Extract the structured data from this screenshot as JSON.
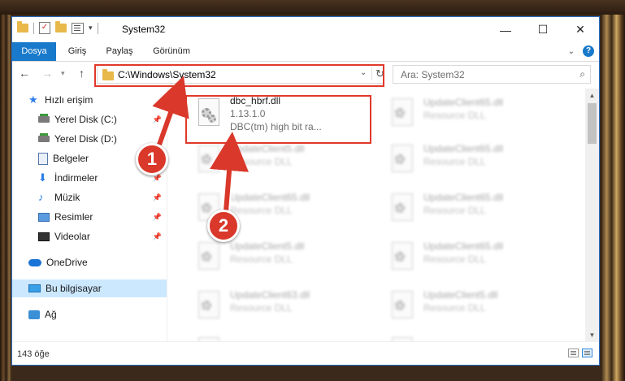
{
  "window": {
    "title": "System32",
    "controls": [
      "—",
      "☐",
      "✕"
    ]
  },
  "ribbon": {
    "tabs": [
      "Dosya",
      "Giriş",
      "Paylaş",
      "Görünüm"
    ],
    "help": "?"
  },
  "address": {
    "path": "C:\\Windows\\System32"
  },
  "search": {
    "placeholder": "Ara: System32"
  },
  "sidebar": {
    "items": [
      {
        "label": "Hızlı erişim",
        "icon": "star-icon"
      },
      {
        "label": "Yerel Disk (C:)",
        "icon": "disk-icon"
      },
      {
        "label": "Yerel Disk (D:)",
        "icon": "disk-icon"
      },
      {
        "label": "Belgeler",
        "icon": "document-icon"
      },
      {
        "label": "İndirmeler",
        "icon": "download-icon"
      },
      {
        "label": "Müzik",
        "icon": "music-icon"
      },
      {
        "label": "Resimler",
        "icon": "picture-icon"
      },
      {
        "label": "Videolar",
        "icon": "video-icon"
      },
      {
        "label": "OneDrive",
        "icon": "cloud-icon"
      },
      {
        "label": "Bu bilgisayar",
        "icon": "computer-icon"
      },
      {
        "label": "Ağ",
        "icon": "network-icon"
      }
    ]
  },
  "files": [
    {
      "name": "dbc_hbrf.dll",
      "version": "1.13.1.0",
      "description": "DBC(tm) high bit ra..."
    },
    {
      "name": "UpdateClient65.dll",
      "description": "Resource DLL"
    },
    {
      "name": "UpdateClient5.dll",
      "description": "Resource DLL"
    },
    {
      "name": "UpdateClient65.dll",
      "description": "Resource DLL"
    },
    {
      "name": "UpdateClient65.dll",
      "description": "Resource DLL"
    },
    {
      "name": "UpdateClient65.dll",
      "description": "Resource DLL"
    },
    {
      "name": "UpdateClient5.dll",
      "description": "Resource DLL"
    },
    {
      "name": "UpdateClient65.dll",
      "description": "Resource DLL"
    },
    {
      "name": "UpdateClient63.dll",
      "description": "Resource DLL"
    },
    {
      "name": "UpdateClient5.dll",
      "description": "Resource DLL"
    },
    {
      "name": "",
      "description": ""
    },
    {
      "name": "",
      "description": ""
    }
  ],
  "status": {
    "item_count": "143 öğe"
  },
  "annotations": {
    "step1": "1",
    "step2": "2",
    "highlight_color": "#e0392b",
    "badge_color": "#d9382a"
  }
}
